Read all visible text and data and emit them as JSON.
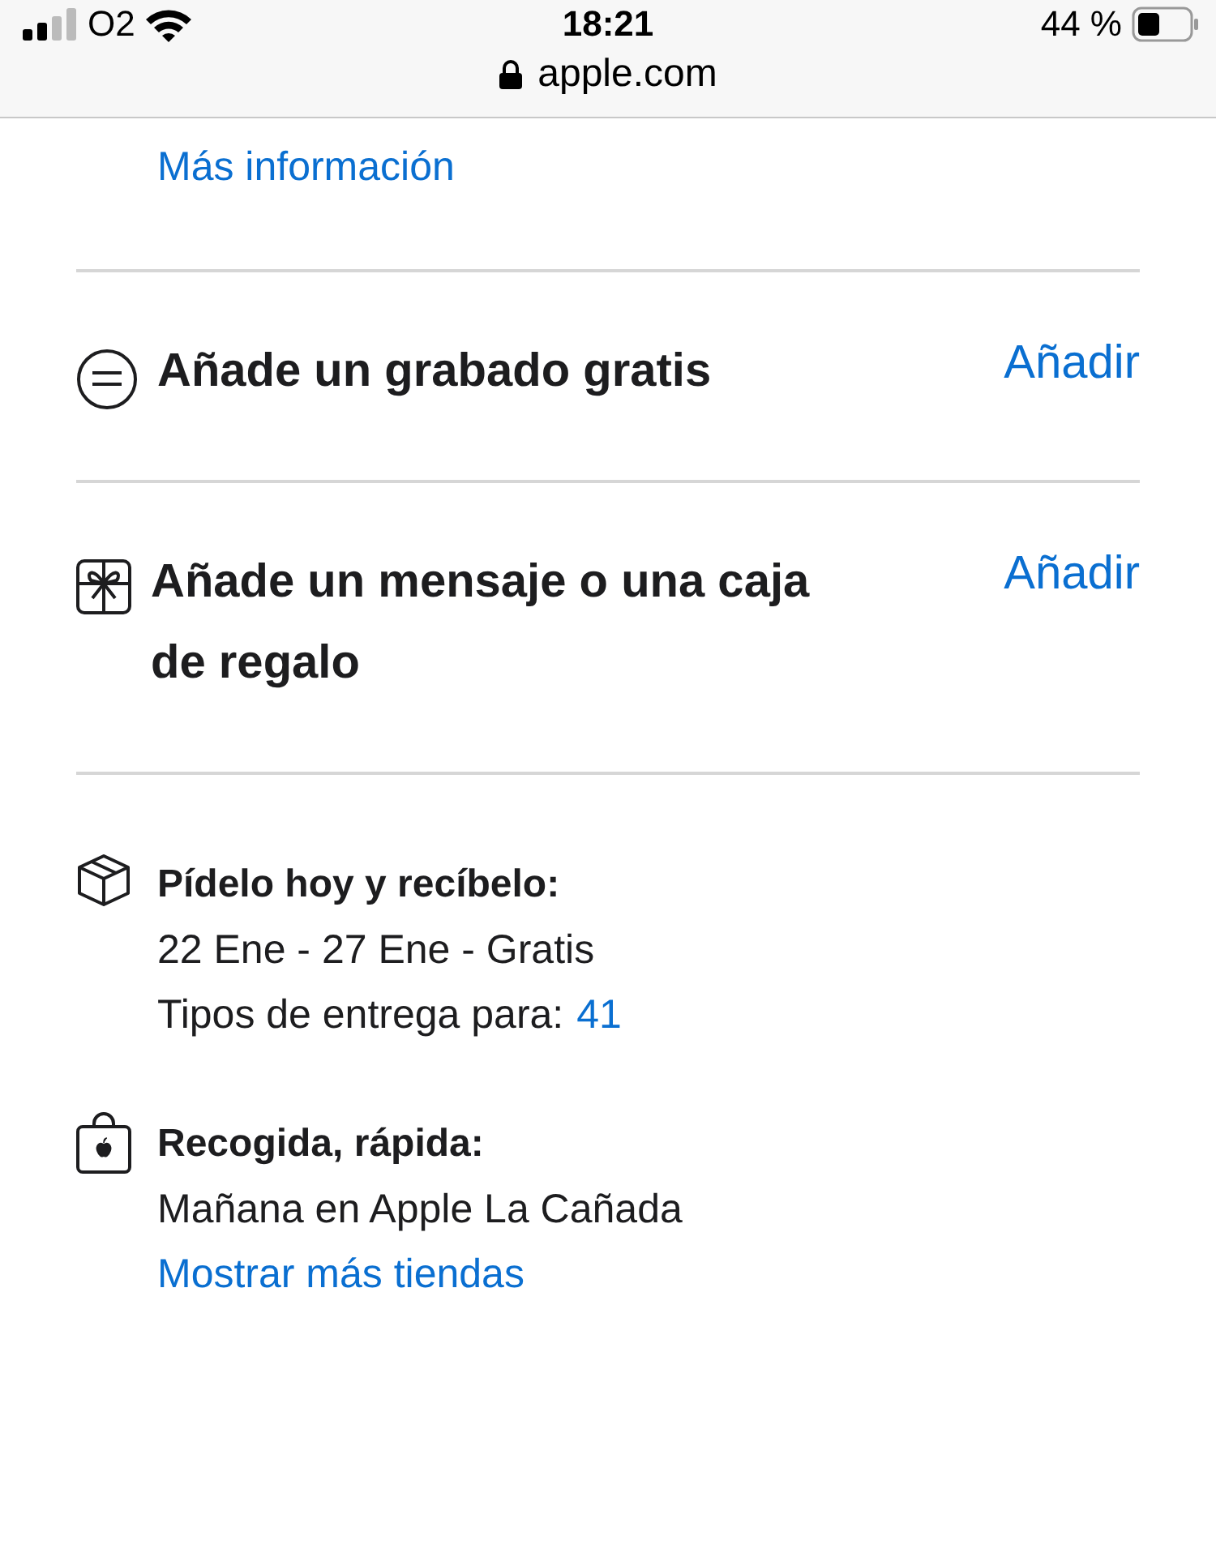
{
  "status_bar": {
    "carrier": "O2",
    "time": "18:21",
    "battery": "44 %"
  },
  "address_bar": {
    "url": "apple.com"
  },
  "top_link": "Más información",
  "options": [
    {
      "kind": "engraving",
      "title": "Añade un grabado gratis",
      "action": "Añadir"
    },
    {
      "kind": "gift",
      "title": "Añade un mensaje o una caja de regalo",
      "action": "Añadir"
    }
  ],
  "availability": [
    {
      "kind": "delivery",
      "title": "Pídelo hoy y recíbelo:",
      "lines": [
        "22 Ene - 27 Ene - Gratis"
      ],
      "label": "Tipos de entrega para:",
      "link": "41"
    },
    {
      "kind": "pickup",
      "title": "Recogida, rápida:",
      "lines": [
        "Mañana en Apple La Cañada"
      ],
      "link": "Mostrar más tiendas"
    }
  ]
}
